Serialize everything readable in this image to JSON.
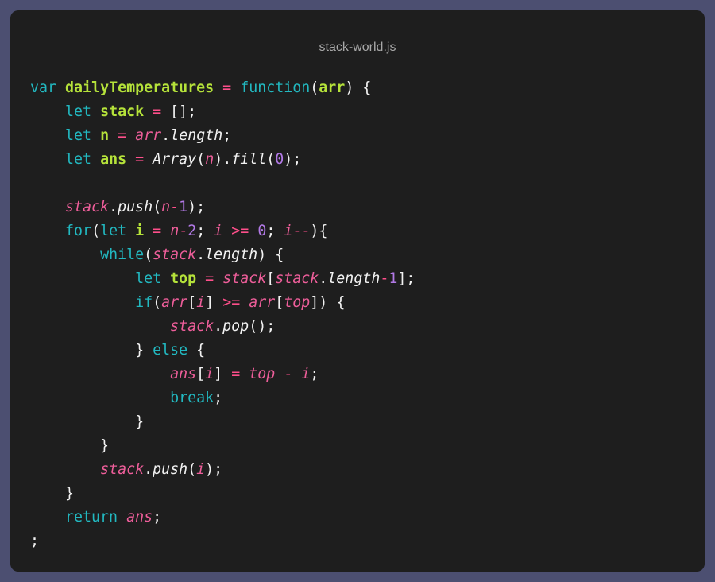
{
  "window": {
    "title": "stack-world.js"
  },
  "code": {
    "lines": [
      [
        [
          "kw",
          "var"
        ],
        [
          "pl",
          " "
        ],
        [
          "fn",
          "dailyTemperatures"
        ],
        [
          "pl",
          " "
        ],
        [
          "op",
          "="
        ],
        [
          "pl",
          " "
        ],
        [
          "kw",
          "function"
        ],
        [
          "pl",
          "("
        ],
        [
          "fn",
          "arr"
        ],
        [
          "pl",
          ") {"
        ]
      ],
      [
        [
          "pl",
          "    "
        ],
        [
          "kw",
          "let"
        ],
        [
          "pl",
          " "
        ],
        [
          "fn",
          "stack"
        ],
        [
          "pl",
          " "
        ],
        [
          "op",
          "="
        ],
        [
          "pl",
          " [];"
        ]
      ],
      [
        [
          "pl",
          "    "
        ],
        [
          "kw",
          "let"
        ],
        [
          "pl",
          " "
        ],
        [
          "fn",
          "n"
        ],
        [
          "pl",
          " "
        ],
        [
          "op",
          "="
        ],
        [
          "pl",
          " "
        ],
        [
          "var",
          "arr"
        ],
        [
          "pl",
          "."
        ],
        [
          "prop",
          "length"
        ],
        [
          "pl",
          ";"
        ]
      ],
      [
        [
          "pl",
          "    "
        ],
        [
          "kw",
          "let"
        ],
        [
          "pl",
          " "
        ],
        [
          "fn",
          "ans"
        ],
        [
          "pl",
          " "
        ],
        [
          "op",
          "="
        ],
        [
          "pl",
          " "
        ],
        [
          "prop",
          "Array"
        ],
        [
          "pl",
          "("
        ],
        [
          "var",
          "n"
        ],
        [
          "pl",
          ")."
        ],
        [
          "prop",
          "fill"
        ],
        [
          "pl",
          "("
        ],
        [
          "num",
          "0"
        ],
        [
          "pl",
          ");"
        ]
      ],
      [],
      [
        [
          "pl",
          "    "
        ],
        [
          "var",
          "stack"
        ],
        [
          "pl",
          "."
        ],
        [
          "prop",
          "push"
        ],
        [
          "pl",
          "("
        ],
        [
          "var",
          "n"
        ],
        [
          "op",
          "-"
        ],
        [
          "num",
          "1"
        ],
        [
          "pl",
          ");"
        ]
      ],
      [
        [
          "pl",
          "    "
        ],
        [
          "kw",
          "for"
        ],
        [
          "pl",
          "("
        ],
        [
          "kw",
          "let"
        ],
        [
          "pl",
          " "
        ],
        [
          "fn",
          "i"
        ],
        [
          "pl",
          " "
        ],
        [
          "op",
          "="
        ],
        [
          "pl",
          " "
        ],
        [
          "var",
          "n"
        ],
        [
          "op",
          "-"
        ],
        [
          "num",
          "2"
        ],
        [
          "pl",
          "; "
        ],
        [
          "var",
          "i"
        ],
        [
          "pl",
          " "
        ],
        [
          "op",
          ">="
        ],
        [
          "pl",
          " "
        ],
        [
          "num",
          "0"
        ],
        [
          "pl",
          "; "
        ],
        [
          "var",
          "i"
        ],
        [
          "op",
          "--"
        ],
        [
          "pl",
          "){"
        ]
      ],
      [
        [
          "pl",
          "        "
        ],
        [
          "kw",
          "while"
        ],
        [
          "pl",
          "("
        ],
        [
          "var",
          "stack"
        ],
        [
          "pl",
          "."
        ],
        [
          "prop",
          "length"
        ],
        [
          "pl",
          ") {"
        ]
      ],
      [
        [
          "pl",
          "            "
        ],
        [
          "kw",
          "let"
        ],
        [
          "pl",
          " "
        ],
        [
          "fn",
          "top"
        ],
        [
          "pl",
          " "
        ],
        [
          "op",
          "="
        ],
        [
          "pl",
          " "
        ],
        [
          "var",
          "stack"
        ],
        [
          "pl",
          "["
        ],
        [
          "var",
          "stack"
        ],
        [
          "pl",
          "."
        ],
        [
          "prop",
          "length"
        ],
        [
          "op",
          "-"
        ],
        [
          "num",
          "1"
        ],
        [
          "pl",
          "];"
        ]
      ],
      [
        [
          "pl",
          "            "
        ],
        [
          "kw",
          "if"
        ],
        [
          "pl",
          "("
        ],
        [
          "var",
          "arr"
        ],
        [
          "pl",
          "["
        ],
        [
          "var",
          "i"
        ],
        [
          "pl",
          "] "
        ],
        [
          "op",
          ">="
        ],
        [
          "pl",
          " "
        ],
        [
          "var",
          "arr"
        ],
        [
          "pl",
          "["
        ],
        [
          "var",
          "top"
        ],
        [
          "pl",
          "]) {"
        ]
      ],
      [
        [
          "pl",
          "                "
        ],
        [
          "var",
          "stack"
        ],
        [
          "pl",
          "."
        ],
        [
          "prop",
          "pop"
        ],
        [
          "pl",
          "();"
        ]
      ],
      [
        [
          "pl",
          "            } "
        ],
        [
          "kw",
          "else"
        ],
        [
          "pl",
          " {"
        ]
      ],
      [
        [
          "pl",
          "                "
        ],
        [
          "var",
          "ans"
        ],
        [
          "pl",
          "["
        ],
        [
          "var",
          "i"
        ],
        [
          "pl",
          "] "
        ],
        [
          "op",
          "="
        ],
        [
          "pl",
          " "
        ],
        [
          "var",
          "top"
        ],
        [
          "pl",
          " "
        ],
        [
          "op",
          "-"
        ],
        [
          "pl",
          " "
        ],
        [
          "var",
          "i"
        ],
        [
          "pl",
          ";"
        ]
      ],
      [
        [
          "pl",
          "                "
        ],
        [
          "kw",
          "break"
        ],
        [
          "pl",
          ";"
        ]
      ],
      [
        [
          "pl",
          "            }"
        ]
      ],
      [
        [
          "pl",
          "        }"
        ]
      ],
      [
        [
          "pl",
          "        "
        ],
        [
          "var",
          "stack"
        ],
        [
          "pl",
          "."
        ],
        [
          "prop",
          "push"
        ],
        [
          "pl",
          "("
        ],
        [
          "var",
          "i"
        ],
        [
          "pl",
          ");"
        ]
      ],
      [
        [
          "pl",
          "    }"
        ]
      ],
      [
        [
          "pl",
          "    "
        ],
        [
          "kw",
          "return"
        ],
        [
          "pl",
          " "
        ],
        [
          "var",
          "ans"
        ],
        [
          "pl",
          ";"
        ]
      ],
      [
        [
          "pl",
          ";"
        ]
      ]
    ]
  }
}
